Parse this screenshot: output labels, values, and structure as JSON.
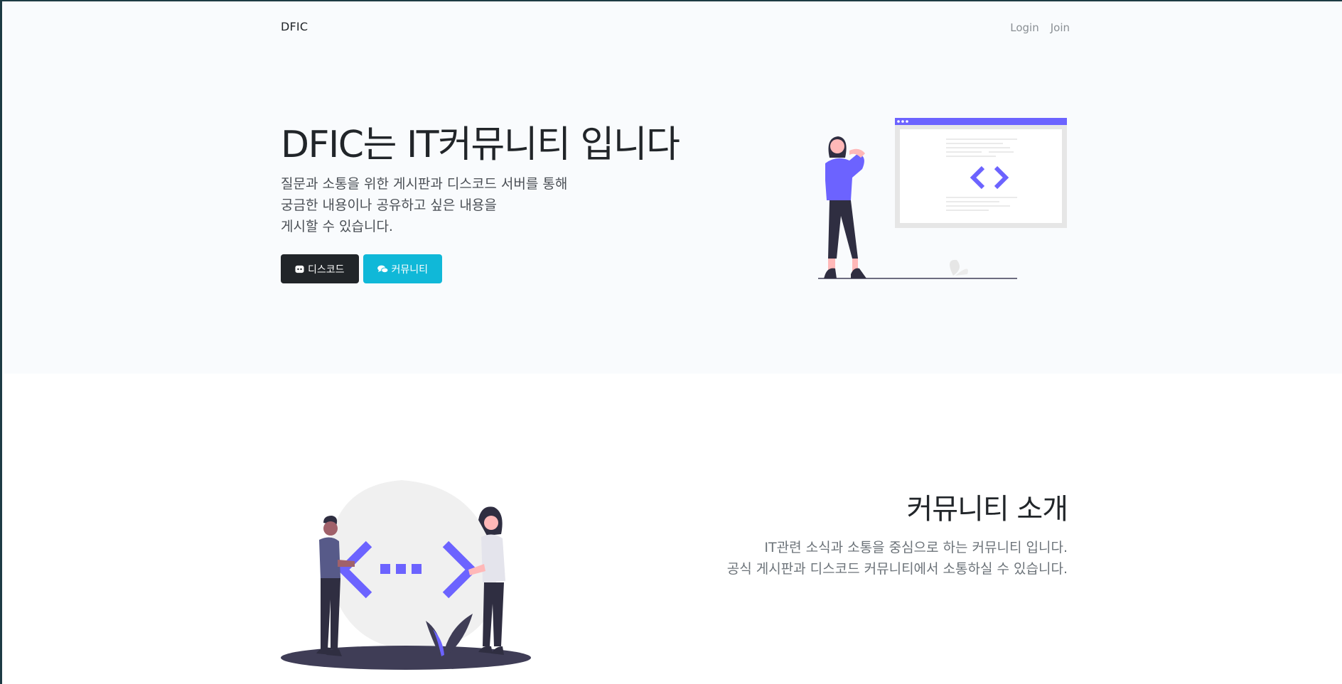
{
  "nav": {
    "brand": "DFIC",
    "links": [
      {
        "label": "Login"
      },
      {
        "label": "Join"
      }
    ]
  },
  "hero": {
    "title": "DFIC는 IT커뮤니티 입니다",
    "description_lines": [
      "질문과 소통을 위한 게시판과 디스코드 서버를 통해",
      "궁금한 내용이나 공유하고 싶은 내용을",
      "게시할 수 있습니다."
    ],
    "buttons": [
      {
        "label": "디스코드",
        "icon": "discord-icon",
        "color": "#212529"
      },
      {
        "label": "커뮤니티",
        "icon": "comments-icon",
        "color": "#10b8d8"
      }
    ]
  },
  "about": {
    "title": "커뮤니티 소개",
    "description_lines": [
      "IT관련 소식과 소통을 중심으로 하는 커뮤니티 입니다.",
      "공식 게시판과 디스코드 커뮤니티에서 소통하실 수 있습니다."
    ]
  },
  "colors": {
    "accent": "#6c63ff",
    "hero_bg": "#f9fbfd",
    "dark": "#212529",
    "info": "#10b8d8"
  }
}
